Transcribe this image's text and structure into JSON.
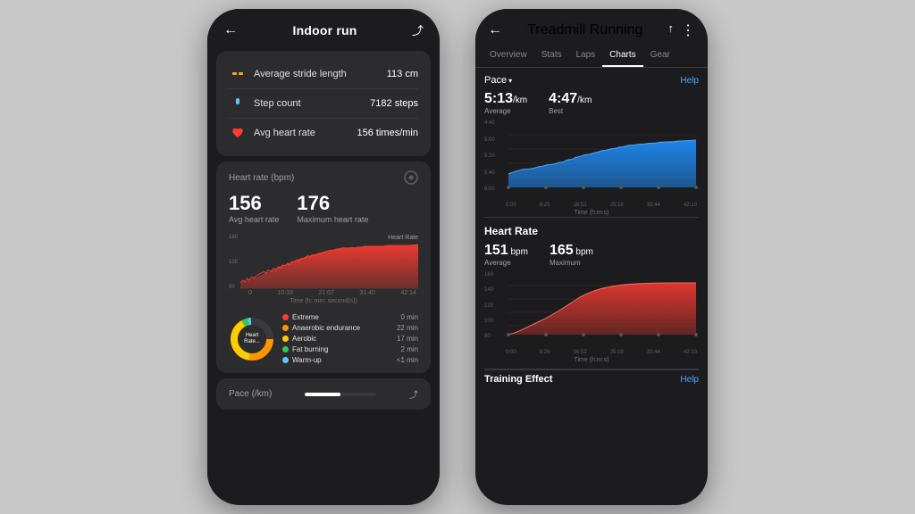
{
  "left_phone": {
    "header": {
      "title": "Indoor run",
      "back_icon": "←",
      "route_icon": "⤴"
    },
    "stats": [
      {
        "icon": "stride",
        "icon_color": "#f5a623",
        "label": "Average stride length",
        "value": "113 cm"
      },
      {
        "icon": "step",
        "icon_color": "#5ac8fa",
        "label": "Step count",
        "value": "7182 steps"
      },
      {
        "icon": "heart",
        "icon_color": "#ff3b30",
        "label": "Avg heart rate",
        "value": "156 times/min"
      }
    ],
    "heart_rate": {
      "title": "Heart rate (bpm)",
      "avg_label": "Avg heart rate",
      "avg_value": "156",
      "max_label": "Maximum heart rate",
      "max_value": "176",
      "chart_label": "Heart Rate",
      "y_max": "180",
      "y_mid": "135",
      "y_min": "90",
      "x_labels": [
        "0",
        "10:33",
        "21:07",
        "31:40",
        "42:14"
      ],
      "time_axis": "Time (h: min: second(s))"
    },
    "zones": [
      {
        "name": "Extreme",
        "color": "#ff3b30",
        "time": "0 min"
      },
      {
        "name": "Anaerobic endurance",
        "color": "#ff9500",
        "time": "22 min"
      },
      {
        "name": "Aerobic",
        "color": "#ffcc00",
        "time": "17 min"
      },
      {
        "name": "Fat burning",
        "color": "#34c759",
        "time": "2 min"
      },
      {
        "name": "Warm-up",
        "color": "#5ac8fa",
        "time": "<1 min"
      }
    ],
    "pace_section": {
      "label": "Pace (/km)",
      "icon": "⤴"
    }
  },
  "right_phone": {
    "header": {
      "title": "Treadmill Running",
      "back_icon": "←",
      "share_icon": "↑",
      "more_icon": "⋮"
    },
    "tabs": [
      "Overview",
      "Stats",
      "Laps",
      "Charts",
      "Gear"
    ],
    "active_tab": "Charts",
    "pace_chart": {
      "dropdown_label": "Pace",
      "help_label": "Help",
      "average_label": "Average",
      "average_value": "5:13",
      "average_unit": "/km",
      "best_label": "Best",
      "best_value": "4:47",
      "best_unit": "/km",
      "y_labels": [
        "4:40",
        "5:00",
        "5:20",
        "5:40",
        "6:00"
      ],
      "x_labels": [
        "0:00",
        "8:25",
        "16:52",
        "25:18",
        "33:44",
        "42:10"
      ],
      "x_axis_label": "Time (h:m:s)"
    },
    "heart_rate_chart": {
      "title": "Heart Rate",
      "avg_label": "Average",
      "avg_value": "151",
      "avg_unit": " bpm",
      "max_label": "Maximum",
      "max_value": "165",
      "max_unit": " bpm",
      "y_labels": [
        "160",
        "140",
        "120",
        "100",
        "80"
      ],
      "x_labels": [
        "0:00",
        "8:26",
        "16:52",
        "25:18",
        "33:44",
        "42:10"
      ],
      "x_axis_label": "Time (h:m:s)"
    },
    "training_effect": {
      "label": "Training Effect",
      "help_label": "Help"
    }
  }
}
